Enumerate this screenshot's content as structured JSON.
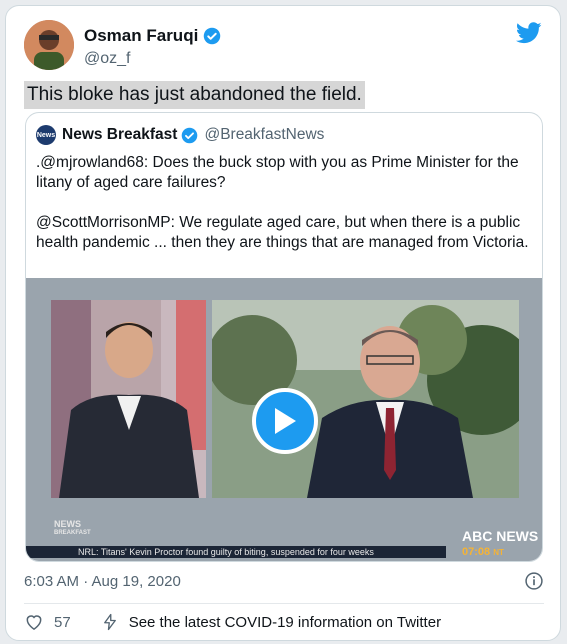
{
  "author": {
    "name": "Osman Faruqi",
    "handle": "@oz_f"
  },
  "icons": {
    "verified": "verified-badge-icon",
    "platform": "twitter-bird-icon",
    "play": "play-icon",
    "info": "info-icon",
    "like": "heart-icon",
    "covid": "lightning-bolt-icon"
  },
  "colors": {
    "accent": "#1d9bf0",
    "secondary_text": "#536471"
  },
  "tweet": {
    "text": "This bloke has just abandoned the field.",
    "timestamp": "6:03 AM · Aug 19, 2020",
    "likes": "57",
    "covid_notice": "See the latest COVID-19 information on Twitter"
  },
  "quoted": {
    "logo_text": "News",
    "name": "News Breakfast",
    "handle": "@BreakfastNews",
    "paragraph1": ".@mjrowland68: Does the buck stop with you as Prime Minister for the litany of aged care failures?",
    "paragraph2": "@ScottMorrisonMP: We regulate aged care, but when there is a public health pandemic ... then they are things that are managed from Victoria.",
    "video": {
      "channel_logo": "ABC NEWS",
      "time": "07:08",
      "time_suffix": "NT",
      "left_logo_line1": "NEWS",
      "left_logo_line2": "BREAKFAST",
      "ticker": "NRL: Titans' Kevin Proctor found guilty of biting, suspended for four weeks"
    }
  }
}
